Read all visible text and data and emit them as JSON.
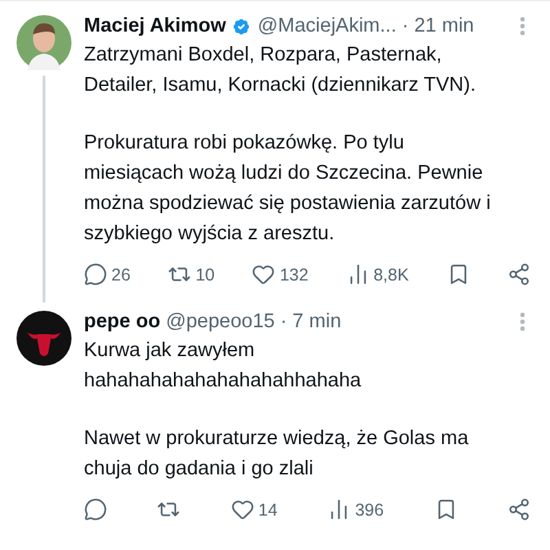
{
  "tweets": [
    {
      "avatar": {
        "kind": "photo"
      },
      "name": "Maciej Akimow",
      "verified": true,
      "handle": "@MaciejAkim...",
      "separator": "·",
      "time": "21 min",
      "thread_line": true,
      "paragraphs": [
        "Zatrzymani Boxdel, Rozpara, Pasternak,\nDetailer, Isamu, Kornacki (dziennikarz TVN).",
        "Prokuratura robi pokazówkę. Po tylu\nmiesiącach wożą ludzi do Szczecina. Pewnie\nmożna spodziewać się postawienia zarzutów i\nszybkiego wyjścia z aresztu."
      ],
      "actions": [
        {
          "kind": "reply",
          "count": "26"
        },
        {
          "kind": "repost",
          "count": "10"
        },
        {
          "kind": "like",
          "count": "132"
        },
        {
          "kind": "views",
          "count": "8,8K"
        },
        {
          "kind": "bookmark"
        },
        {
          "kind": "share"
        }
      ]
    },
    {
      "avatar": {
        "kind": "logo"
      },
      "name": "pepe oo",
      "verified": false,
      "handle": "@pepeoo15",
      "separator": "·",
      "time": "7 min",
      "thread_line": false,
      "paragraphs": [
        "Kurwa jak zawyłem\nhahahahahahahahahahhahaha",
        "Nawet w prokuraturze wiedzą, że Golas ma\nchuja do gadania i go zlali"
      ],
      "actions": [
        {
          "kind": "reply"
        },
        {
          "kind": "repost"
        },
        {
          "kind": "like",
          "count": "14"
        },
        {
          "kind": "views",
          "count": "396"
        },
        {
          "kind": "bookmark"
        },
        {
          "kind": "share"
        }
      ]
    }
  ]
}
